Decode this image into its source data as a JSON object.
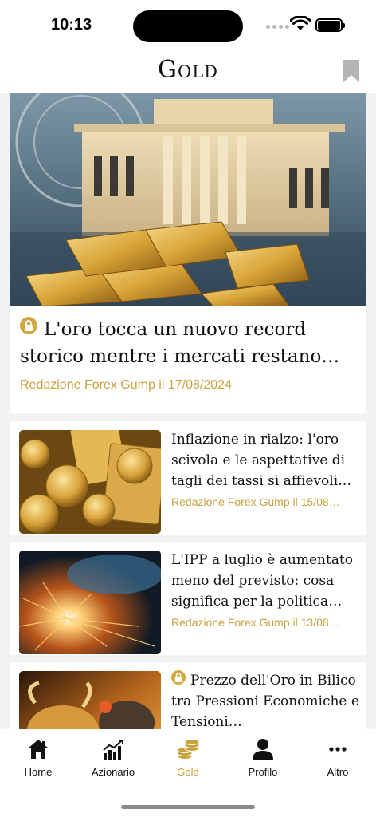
{
  "status": {
    "time": "10:13"
  },
  "header": {
    "title": "Gold"
  },
  "featured": {
    "title": "L'oro tocca un nuovo record storico mentre i mercati restano…",
    "meta": "Redazione Forex Gump il 17/08/2024",
    "locked": true
  },
  "articles": [
    {
      "title": "Inflazione in rialzo: l'oro scivola e le aspettative di tagli dei tassi si affievoli…",
      "meta": "Redazione Forex Gump il 15/08…",
      "locked": false
    },
    {
      "title": "L'IPP a luglio è aumentato meno del previsto: cosa significa per la politica…",
      "meta": "Redazione Forex Gump il 13/08…",
      "locked": false
    },
    {
      "title": "Prezzo dell'Oro in Bilico tra Pressioni Economiche e Tensioni…",
      "meta": "",
      "locked": true
    }
  ],
  "tabs": [
    {
      "label": "Home",
      "icon": "home-icon",
      "active": false
    },
    {
      "label": "Azionario",
      "icon": "chart-icon",
      "active": false
    },
    {
      "label": "Gold",
      "icon": "gold-coins-icon",
      "active": true
    },
    {
      "label": "Profilo",
      "icon": "profile-icon",
      "active": false
    },
    {
      "label": "Altro",
      "icon": "more-icon",
      "active": false
    }
  ],
  "colors": {
    "accent": "#c9a23e",
    "lock_badge": "#d2a940",
    "feed_background": "#f2f2f2"
  }
}
